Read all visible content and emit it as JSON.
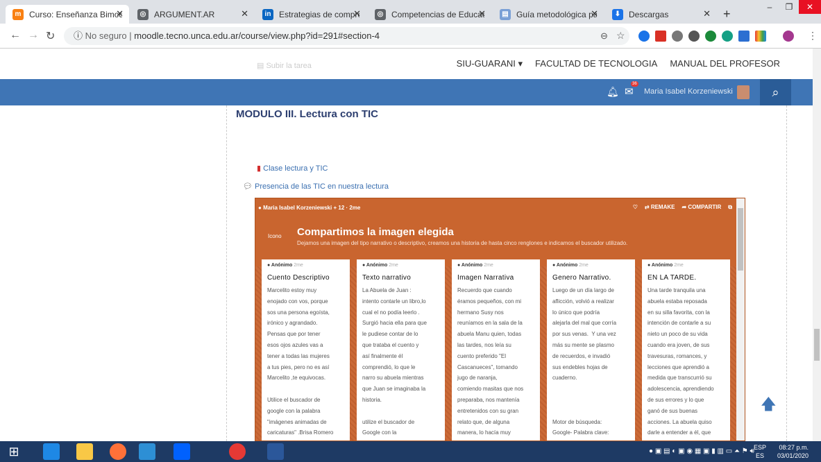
{
  "browser": {
    "tabs": [
      {
        "label": "Curso: Enseñanza Bimoda",
        "icon": "moodle-icon",
        "color": "#f98012"
      },
      {
        "label": "ARGUMENT.AR",
        "icon": "globe-icon",
        "color": "#5f6368"
      },
      {
        "label": "Estrategias de comprensi",
        "icon": "linkedin-icon",
        "color": "#0a66c2"
      },
      {
        "label": "Competencias de Educac",
        "icon": "globe-icon",
        "color": "#5f6368"
      },
      {
        "label": "Guía metodológica para",
        "icon": "document-icon",
        "color": "#7aa0d6"
      },
      {
        "label": "Descargas",
        "icon": "download-icon",
        "color": "#1a73e8"
      }
    ],
    "address": {
      "security": "No seguro",
      "url": "moodle.tecno.unca.edu.ar/course/view.php?id=291#section-4"
    }
  },
  "moodle": {
    "submit_task": "Subir la tarea",
    "nav": [
      "SIU-GUARANI ▾",
      "FACULTAD DE TECNOLOGIA",
      "MANUAL DEL PROFESOR"
    ],
    "notif_count": "36",
    "user_name": "Maria Isabel Korzeniewski",
    "module_title": "MODULO III. Lectura con TIC",
    "activities": [
      "Clase lectura y TIC",
      "Presencia de las TIC en nuestra lectura"
    ]
  },
  "padlet": {
    "author": "Maria Isabel Korzeniewski",
    "meta": "+ 12 · 2me",
    "actions": [
      "REMAKE",
      "COMPARTIR"
    ],
    "icon_alt": "Icono",
    "title": "Compartimos la imagen elegida",
    "subtitle": "Dejamos una imagen del tipo narrativo o descriptivo, creamos una historia de hasta cinco renglones e indicamos el buscador utilizado.",
    "cards": [
      {
        "author": "Anónimo",
        "time": "2me",
        "title": "Cuento Descriptivo",
        "body": "Marcelito estoy muy\nenojado con vos, porque\nsos una persona egoísta,\nirónico y agrandado.\nPensas que por tener\nesos ojos azules vas a\ntener a todas las mujeres\na tus pies, pero no es así\nMarcelito ,te equivocas.\n\nUtilice el buscador de\ngoogle con la palabra\n\"imágenes animadas de\ncaricaturas\" .Brisa Romero"
      },
      {
        "author": "Anónimo",
        "time": "2me",
        "title": "Texto narrativo",
        "body": "La Abuela de Juan :\nintento contarle un libro,lo\ncual el no podía leerlo .\nSurgió hacia ella para que\nle pudiese contar de lo\nque trataba el cuento y\nasí finalmente él\ncomprendió, lo que le\nnarro su abuela mientras\nque Juan se imaginaba la\nhistoria.\n\nutilize el buscador de\nGoogle con la"
      },
      {
        "author": "Anónimo",
        "time": "2me",
        "title": "Imagen Narrativa",
        "body": "Recuerdo que cuando\néramos pequeños, con mi\nhermano Susy nos\nreuníamos en la sala de la\nabuela Manu quien, todas\nlas tardes, nos leía su\ncuento preferido \"El\nCascanueces\", tomando\njugo de naranja,\ncomiendo masitas que nos\npreparaba, nos mantenía\nentretenidos con su gran\nrelato que, de alguna\nmanera, lo hacía muy"
      },
      {
        "author": "Anónimo",
        "time": "2me",
        "title": "Genero Narrativo.",
        "body": "Luego de un día largo de\naflicción, volvió a realizar\nlo único que podría\nalejarla del mal que corría\npor sus venas.  Y una vez\nmás su mente se plasmo\nde recuerdos, e invadió\nsus endebles hojas de\ncuaderno.\n\n\n\nMotor de búsqueda:\nGoogle- Palabra clave:\nImagen Narrativa."
      },
      {
        "author": "Anónimo",
        "time": "2me",
        "title": "EN LA TARDE.",
        "body": "Una tarde tranquila una\nabuela estaba reposada\nen su silla favorita, con la\nintención de contarle a su\nnieto un poco de su vida\ncuando era joven, de sus\ntravesuras, romances, y\nlecciones que aprendió a\nmedida que transcurrió su\nadolescencia, aprendiendo\nde sus errores y lo que\nganó de sus buenas\nacciones. La abuela quiso\ndarle a entender a él, que"
      }
    ]
  },
  "taskbar": {
    "lang": "ESP\nES",
    "time": "08:27 p.m.",
    "date": "03/01/2020"
  }
}
